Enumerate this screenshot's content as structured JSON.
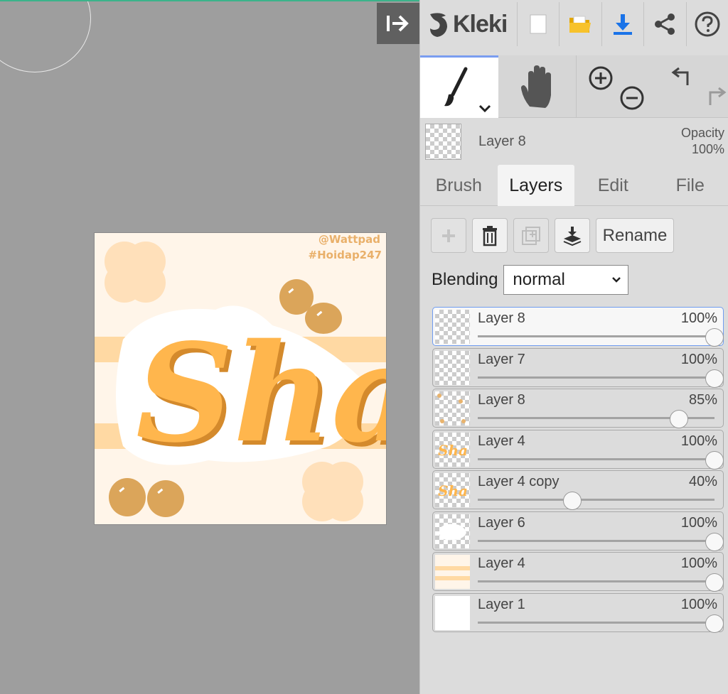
{
  "app": {
    "name": "Kleki"
  },
  "canvas": {
    "watermark_line1": "@Wattpad",
    "watermark_line2": "#Hoidap247",
    "lettering": "Sha"
  },
  "current_layer": {
    "name": "Layer 8",
    "opacity_label": "Opacity",
    "opacity_value": "100%"
  },
  "tabs": [
    {
      "label": "Brush",
      "active": false
    },
    {
      "label": "Layers",
      "active": true
    },
    {
      "label": "Edit",
      "active": false
    },
    {
      "label": "File",
      "active": false
    }
  ],
  "layer_buttons": {
    "rename_label": "Rename"
  },
  "blending": {
    "label": "Blending",
    "value": "normal"
  },
  "layers": [
    {
      "name": "Layer 8",
      "opacity": "100%",
      "opacity_fraction": 1.0,
      "selected": true,
      "thumb": "checker"
    },
    {
      "name": "Layer 7",
      "opacity": "100%",
      "opacity_fraction": 1.0,
      "selected": false,
      "thumb": "checker"
    },
    {
      "name": "Layer 8",
      "opacity": "85%",
      "opacity_fraction": 0.85,
      "selected": false,
      "thumb": "dots"
    },
    {
      "name": "Layer 4",
      "opacity": "100%",
      "opacity_fraction": 1.0,
      "selected": false,
      "thumb": "lettering"
    },
    {
      "name": "Layer 4 copy",
      "opacity": "40%",
      "opacity_fraction": 0.4,
      "selected": false,
      "thumb": "lettering"
    },
    {
      "name": "Layer 6",
      "opacity": "100%",
      "opacity_fraction": 1.0,
      "selected": false,
      "thumb": "white-blob"
    },
    {
      "name": "Layer 4",
      "opacity": "100%",
      "opacity_fraction": 1.0,
      "selected": false,
      "thumb": "stripes"
    },
    {
      "name": "Layer 1",
      "opacity": "100%",
      "opacity_fraction": 1.0,
      "selected": false,
      "thumb": "white"
    }
  ],
  "colors": {
    "accent": "#7a9df0",
    "artwork_bg": "#fff5e9",
    "stripe": "#ffd9a3",
    "letter": "#ffb64d",
    "letter_shadow": "#d48a2c",
    "dot": "#dba55a"
  }
}
